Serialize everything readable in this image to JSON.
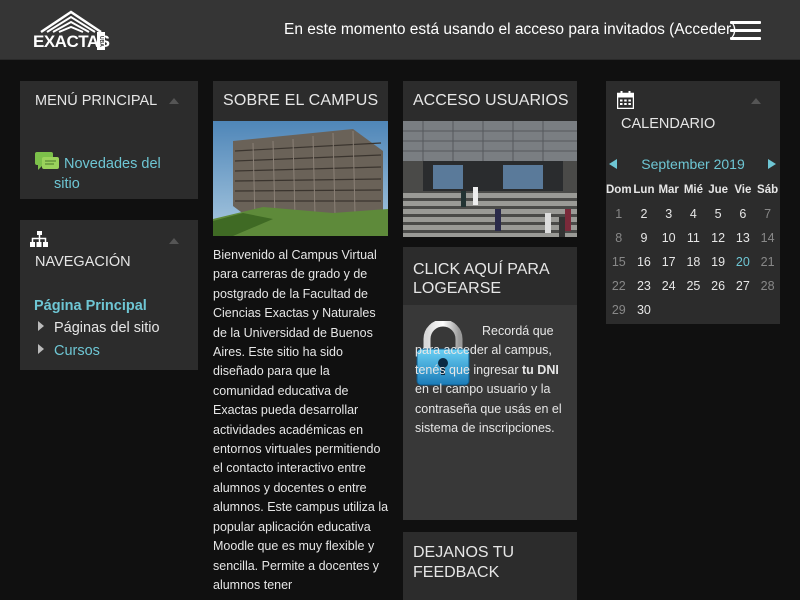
{
  "navbar": {
    "logo_text": "EXACTAS",
    "logo_sub": "UBA",
    "guest_text": "En este momento está usando el acceso para invitados (Acceder)"
  },
  "menu": {
    "title": "MENÚ PRINCIPAL",
    "link": "Novedades del sitio"
  },
  "navigation": {
    "title": "NAVEGACIÓN",
    "home": "Página Principal",
    "items": [
      "Páginas del sitio",
      "Cursos"
    ]
  },
  "sobre": {
    "title": "SOBRE EL CAMPUS",
    "text": "Bienvenido al Campus Virtual para carreras de grado y de postgrado de la Facultad de Ciencias Exactas y Naturales de la Universidad de Buenos Aires. Este sitio ha sido diseñado para que la comunidad educativa de Exactas pueda desarrollar actividades académicas en entornos virtuales permitiendo el contacto interactivo entre alumnos y docentes o entre alumnos. Este campus utiliza la popular aplicación educativa Moodle que es muy flexible y sencilla. Permite a docentes y alumnos tener"
  },
  "acceso": {
    "title": "ACCESO USUARIOS"
  },
  "click": {
    "title": "CLICK AQUÍ PARA LOGEARSE",
    "text_before": "Recordá que para acceder al campus, tenés que ingresar ",
    "text_bold": "tu DNI",
    "text_after": " en el campo usuario y la contraseña que usás en el sistema de inscripciones."
  },
  "feedback": {
    "title": "DEJANOS TU FEEDBACK"
  },
  "calendar": {
    "title": "CALENDARIO",
    "month": "September 2019",
    "weekdays": [
      "Dom",
      "Lun",
      "Mar",
      "Mié",
      "Jue",
      "Vie",
      "Sáb"
    ],
    "weeks": [
      [
        "1",
        "2",
        "3",
        "4",
        "5",
        "6",
        "7"
      ],
      [
        "8",
        "9",
        "10",
        "11",
        "12",
        "13",
        "14"
      ],
      [
        "15",
        "16",
        "17",
        "18",
        "19",
        "20",
        "21"
      ],
      [
        "22",
        "23",
        "24",
        "25",
        "26",
        "27",
        "28"
      ],
      [
        "29",
        "30",
        "",
        "",
        "",
        "",
        ""
      ]
    ],
    "today": "20"
  },
  "colors": {
    "background": "#101010",
    "navbar": "#353535",
    "block": "#2c2c2c",
    "accent": "#6ec6d4"
  }
}
